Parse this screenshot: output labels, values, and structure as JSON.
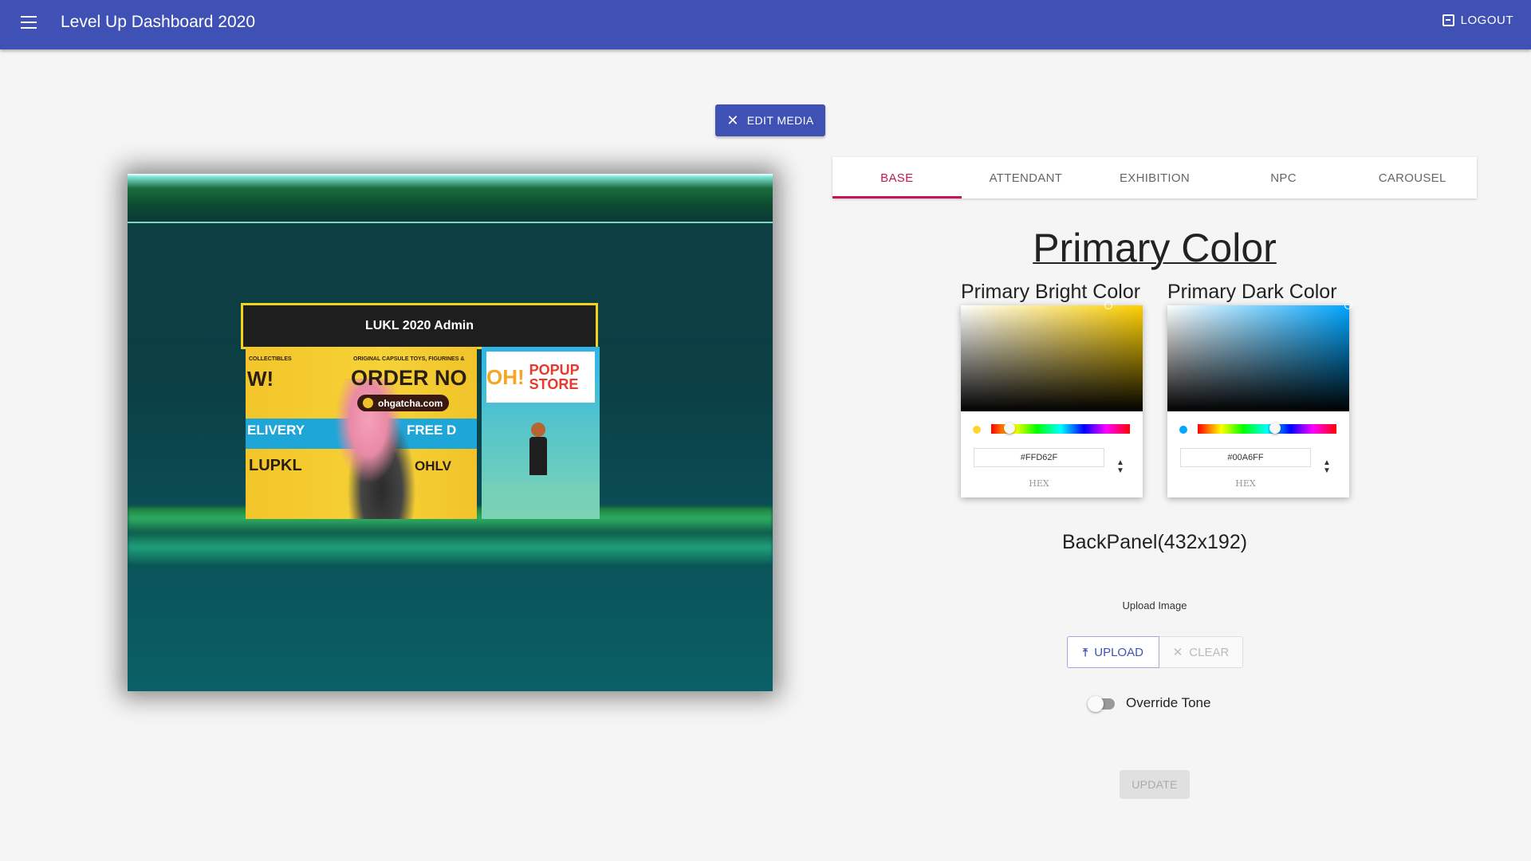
{
  "appbar": {
    "title": "Level Up Dashboard 2020",
    "logout_label": "LOGOUT"
  },
  "edit_media_label": "EDIT MEDIA",
  "preview": {
    "booth_header": "LUKL 2020 Admin",
    "banner": {
      "collectibles": "COLLECTIBLES",
      "original": "ORIGINAL CAPSULE TOYS, FIGURINES &",
      "now_partial": "W!",
      "order_now": "ORDER NO",
      "website": "ohgatcha.com",
      "delivery": "ELIVERY",
      "free": "FREE D",
      "code": "LUPKL",
      "ohlv": "OHLV"
    },
    "popup_logo": {
      "oh": "OH!",
      "text": "POPUP STORE"
    }
  },
  "tabs": [
    {
      "label": "BASE",
      "active": true
    },
    {
      "label": "ATTENDANT",
      "active": false
    },
    {
      "label": "EXHIBITION",
      "active": false
    },
    {
      "label": "NPC",
      "active": false
    },
    {
      "label": "CAROUSEL",
      "active": false
    }
  ],
  "section_title": "Primary Color",
  "pickers": [
    {
      "label": "Primary Bright Color",
      "hex": "#FFD62F",
      "hex_caption": "HEX",
      "hue_color": "#ffd000",
      "swatch": "#ffd62f"
    },
    {
      "label": "Primary Dark Color",
      "hex": "#00A6FF",
      "hex_caption": "HEX",
      "hue_color": "#00a6ff",
      "swatch": "#00a6ff"
    }
  ],
  "backpanel_label": "BackPanel(432x192)",
  "upload": {
    "caption": "Upload Image",
    "upload_label": "UPLOAD",
    "clear_label": "CLEAR"
  },
  "override_tone": {
    "label": "Override Tone",
    "enabled": false
  },
  "update_label": "UPDATE",
  "colors": {
    "primary": "#3f51b5",
    "tab_accent": "#c2185b"
  },
  "icons": [
    "menu-icon",
    "logout-icon",
    "close-icon",
    "upload-icon"
  ]
}
